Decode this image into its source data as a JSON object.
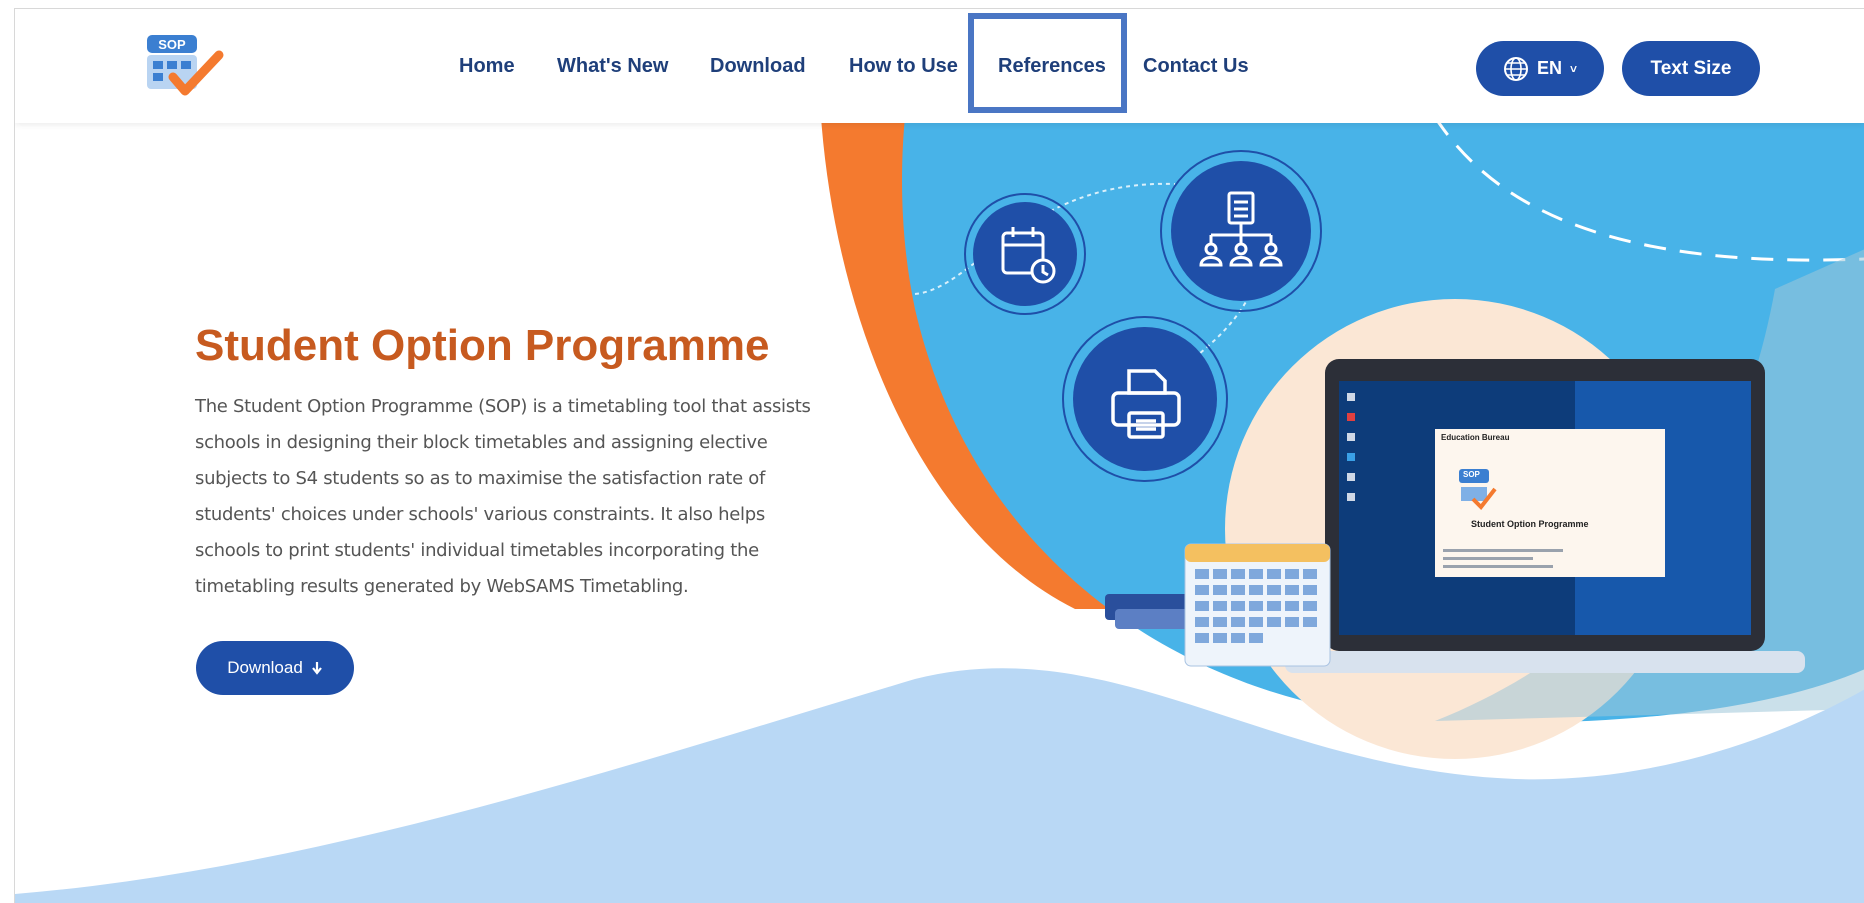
{
  "header": {
    "logo_text": "SOP",
    "nav": [
      {
        "label": "Home"
      },
      {
        "label": "What's New"
      },
      {
        "label": "Download"
      },
      {
        "label": "How to Use"
      },
      {
        "label": "References"
      },
      {
        "label": "Contact Us"
      }
    ],
    "lang_label": "EN",
    "lang_caret": "˅",
    "text_size_label": "Text Size"
  },
  "hero": {
    "title": "Student Option Programme",
    "description_lines": [
      "The Student Option Programme (SOP) is a timetabling tool that assists",
      "schools in designing their block timetables and assigning elective",
      "subjects to S4 students so as to maximise the satisfaction rate of",
      "students' choices under schools' various constraints. It also helps",
      "schools to print students' individual timetables incorporating the",
      "timetabling results generated by WebSAMS Timetabling."
    ],
    "download_label": "Download",
    "download_icon": "down-arrow-icon"
  },
  "laptop_window": {
    "window_title": "Education Bureau",
    "app_name": "Student Option Programme",
    "logo_text": "SOP"
  },
  "colors": {
    "brand_blue": "#1f4fa8",
    "nav_text": "#1f3f7a",
    "title_orange": "#c75a1f",
    "sky_blue": "#48b3e8",
    "wave_blue": "#b9d8f5",
    "accent_orange": "#f47a2f",
    "highlight": "#4a76c4"
  }
}
